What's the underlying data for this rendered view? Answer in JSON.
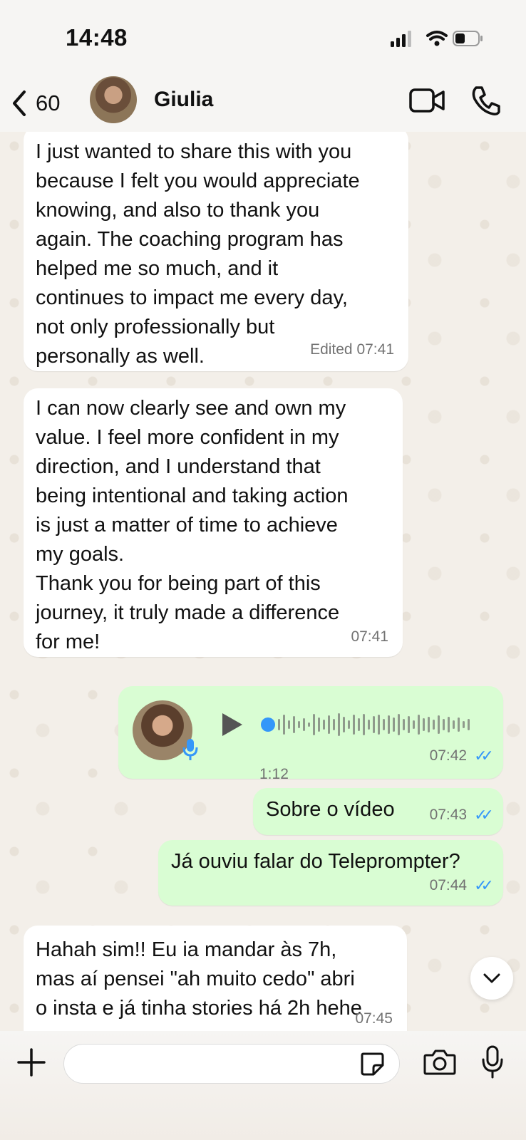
{
  "status_bar": {
    "time": "14:48"
  },
  "header": {
    "back_count": "60",
    "contact_name": "Giulia"
  },
  "messages": [
    {
      "direction": "incoming",
      "text": "I just wanted to share this with you\nbecause I felt you would appreciate\nknowing, and also to thank you\nagain. The coaching program has\nhelped me so much, and it\ncontinues to impact me every day,\nnot only professionally but\npersonally as well.",
      "meta": "Edited 07:41"
    },
    {
      "direction": "incoming",
      "text": "I can now clearly see and own my\nvalue. I feel more confident in my\ndirection, and I understand that\nbeing intentional and taking action\nis just a matter of time to achieve\nmy goals.\nThank you for being part of this\njourney, it truly made a difference\nfor me!",
      "meta": "07:41"
    },
    {
      "direction": "outgoing",
      "type": "voice",
      "duration": "1:12",
      "meta": "07:42",
      "read": true
    },
    {
      "direction": "outgoing",
      "text": "Sobre o vídeo",
      "meta": "07:43",
      "read": true
    },
    {
      "direction": "outgoing",
      "text": "Já ouviu falar do Teleprompter?",
      "meta": "07:44",
      "read": true
    },
    {
      "direction": "incoming",
      "text": "Hahah sim!! Eu ia mandar às 7h,\nmas aí pensei \"ah muito cedo\" abri\no insta e já tinha stories há 2h hehe",
      "meta": "07:45"
    }
  ],
  "composer": {
    "placeholder": ""
  },
  "colors": {
    "incoming_bubble": "#ffffff",
    "outgoing_bubble": "#d9fdd3",
    "read_ticks": "#3497f9",
    "voice_dot": "#3497f9"
  },
  "icons": [
    "back-chevron-icon",
    "video-camera-icon",
    "phone-icon",
    "play-icon",
    "mic-icon",
    "plus-icon",
    "sticker-icon",
    "camera-icon",
    "chevron-down-icon"
  ]
}
